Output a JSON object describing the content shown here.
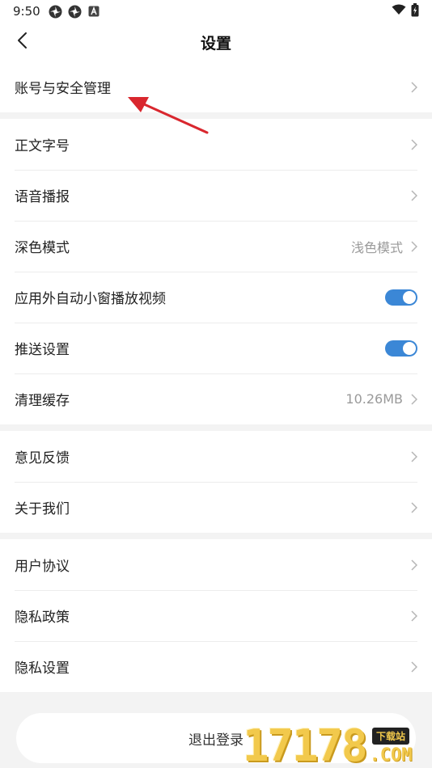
{
  "status_bar": {
    "time": "9:50",
    "icons_left": [
      "pinwheel-icon",
      "pinwheel-icon",
      "a-box-icon"
    ],
    "icons_right": [
      "wifi-icon",
      "battery-charging-icon"
    ]
  },
  "nav": {
    "title": "设置",
    "back_icon": "chevron-left-icon"
  },
  "groups": [
    {
      "items": [
        {
          "label": "账号与安全管理",
          "type": "link"
        }
      ]
    },
    {
      "items": [
        {
          "label": "正文字号",
          "type": "link"
        },
        {
          "label": "语音播报",
          "type": "link"
        },
        {
          "label": "深色模式",
          "type": "link",
          "value": "浅色模式"
        },
        {
          "label": "应用外自动小窗播放视频",
          "type": "toggle",
          "on": true
        },
        {
          "label": "推送设置",
          "type": "toggle",
          "on": true
        },
        {
          "label": "清理缓存",
          "type": "link",
          "value": "10.26MB"
        }
      ]
    },
    {
      "items": [
        {
          "label": "意见反馈",
          "type": "link"
        },
        {
          "label": "关于我们",
          "type": "link"
        }
      ]
    },
    {
      "items": [
        {
          "label": "用户协议",
          "type": "link"
        },
        {
          "label": "隐私政策",
          "type": "link"
        },
        {
          "label": "隐私设置",
          "type": "link"
        }
      ]
    }
  ],
  "logout_label": "退出登录",
  "watermark": {
    "digits": "17178",
    "tag": "下载站",
    "com": ".COM"
  },
  "colors": {
    "toggle_on": "#3b87d6",
    "arrow": "#d9272e",
    "background": "#f3f3f3"
  }
}
